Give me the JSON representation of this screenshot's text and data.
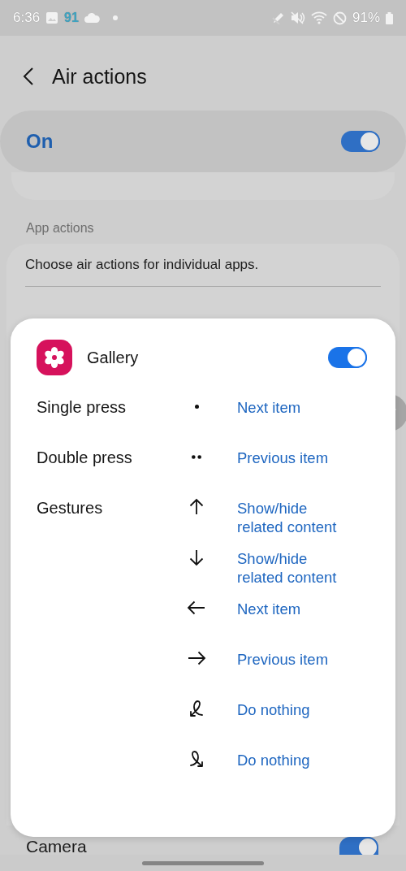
{
  "status_bar": {
    "time": "6:36",
    "notification_count": "91",
    "battery": "91%"
  },
  "header": {
    "title": "Air actions"
  },
  "master_switch": {
    "label": "On",
    "on": true
  },
  "section_title": "App actions",
  "description": "Choose air actions for individual apps.",
  "background_rows": [
    {
      "name": "Camera",
      "on": true
    }
  ],
  "popup": {
    "app": {
      "name": "Gallery",
      "on": true
    },
    "actions": [
      {
        "label": "Single press",
        "kind": "single_press",
        "action": "Next item"
      },
      {
        "label": "Double press",
        "kind": "double_press",
        "action": "Previous item"
      },
      {
        "label": "Gestures",
        "kind": "up",
        "action": "Show/hide related content"
      },
      {
        "kind": "down",
        "action": "Show/hide related content"
      },
      {
        "kind": "left",
        "action": "Next item"
      },
      {
        "kind": "right",
        "action": "Previous item"
      },
      {
        "kind": "loop_ccw",
        "action": "Do nothing"
      },
      {
        "kind": "loop_cw",
        "action": "Do nothing"
      }
    ]
  }
}
